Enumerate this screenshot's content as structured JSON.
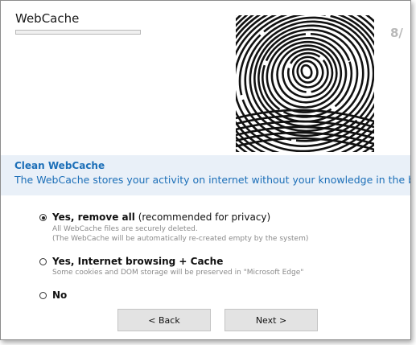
{
  "app": {
    "title": "WebCache",
    "progress": 0.0
  },
  "step_counter": "8/",
  "info": {
    "title": "Clean WebCache",
    "description": "The WebCache stores your activity on internet without your knowledge in the backgr"
  },
  "options": [
    {
      "label_bold": "Yes, remove all",
      "label_rest": " (recommended for privacy)",
      "selected": true,
      "sub": [
        "All WebCache files are securely deleted.",
        "(The WebCache will be automatically re-created empty by the system)"
      ]
    },
    {
      "label_bold": "Yes, Internet browsing + Cache",
      "label_rest": "",
      "selected": false,
      "sub": [
        "Some cookies and DOM storage will be preserved in \"Microsoft Edge\""
      ]
    },
    {
      "label_bold": "No",
      "label_rest": "",
      "selected": false,
      "sub": []
    }
  ],
  "buttons": {
    "back": "< Back",
    "next": "Next >"
  },
  "icons": {
    "illustration": "fingerprint-icon"
  },
  "colors": {
    "accent": "#1c6fb8",
    "band": "#e9f0f8"
  }
}
